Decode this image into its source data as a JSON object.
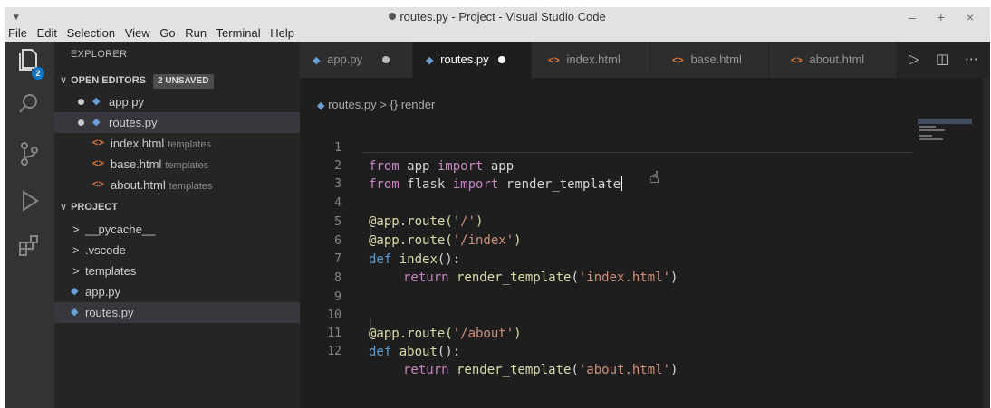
{
  "window": {
    "title": "routes.py - Project - Visual Studio Code",
    "controls": "– + ×",
    "menu": [
      "File",
      "Edit",
      "Selection",
      "View",
      "Go",
      "Run",
      "Terminal",
      "Help"
    ]
  },
  "activity_bar": {
    "items": [
      "explorer-icon",
      "search-icon",
      "source-control-icon",
      "run-debug-icon",
      "extensions-icon"
    ],
    "explorer_badge": "2"
  },
  "sidebar": {
    "title": "EXPLORER",
    "open_editors": {
      "label": "OPEN EDITORS",
      "badge": "2 UNSAVED",
      "items": [
        {
          "name": "app.py",
          "dirty": true,
          "icon": "python-icon"
        },
        {
          "name": "routes.py",
          "dirty": true,
          "icon": "python-icon",
          "selected": true
        },
        {
          "name": "index.html",
          "desc": "templates",
          "icon": "html-icon"
        },
        {
          "name": "base.html",
          "desc": "templates",
          "icon": "html-icon"
        },
        {
          "name": "about.html",
          "desc": "templates",
          "icon": "html-icon"
        }
      ]
    },
    "project": {
      "label": "PROJECT",
      "items": [
        {
          "name": "__pycache__",
          "type": "folder"
        },
        {
          "name": ".vscode",
          "type": "folder"
        },
        {
          "name": "templates",
          "type": "folder"
        },
        {
          "name": "app.py",
          "type": "python-file"
        },
        {
          "name": "routes.py",
          "type": "python-file",
          "selected": true
        }
      ]
    }
  },
  "tabs": [
    {
      "label": "app.py",
      "icon": "python-icon",
      "dirty": true
    },
    {
      "label": "routes.py",
      "icon": "python-icon",
      "dirty": true,
      "active": true
    },
    {
      "label": "index.html",
      "icon": "html-icon"
    },
    {
      "label": "base.html",
      "icon": "html-icon"
    },
    {
      "label": "about.html",
      "icon": "html-icon"
    }
  ],
  "tab_actions": [
    "run-icon",
    "split-editor-icon",
    "more-icon"
  ],
  "breadcrumb": {
    "file": "routes.py",
    "separator": ">",
    "symbol": "{} render"
  },
  "editor": {
    "line_numbers": [
      "1",
      "2",
      "3",
      "4",
      "5",
      "6",
      "7",
      "8",
      "9",
      "10",
      "11",
      "12"
    ],
    "l1": {
      "kw1": "from",
      "mod": " app ",
      "kw2": "import",
      "name": " app"
    },
    "l2": {
      "kw1": "from",
      "mod": " flask ",
      "kw2": "import",
      "name": " render_template"
    },
    "l4": {
      "dec": "@app.route(",
      "str": "'/'",
      "end": ")"
    },
    "l5": {
      "dec": "@app.route(",
      "str": "'/index'",
      "end": ")"
    },
    "l6": {
      "kw": "def",
      "fn": " index",
      "end": "():"
    },
    "l7": {
      "kw": "return",
      "fn": " render_template",
      "open": "(",
      "str": "'index.html'",
      "end": ")"
    },
    "l10": {
      "dec": "@app.route(",
      "str": "'/about'",
      "end": ")"
    },
    "l11": {
      "kw": "def",
      "fn": " about",
      "end": "():"
    },
    "l12": {
      "kw": "return",
      "fn": " render_template",
      "open": "(",
      "str": "'about.html'",
      "end": ")"
    }
  }
}
